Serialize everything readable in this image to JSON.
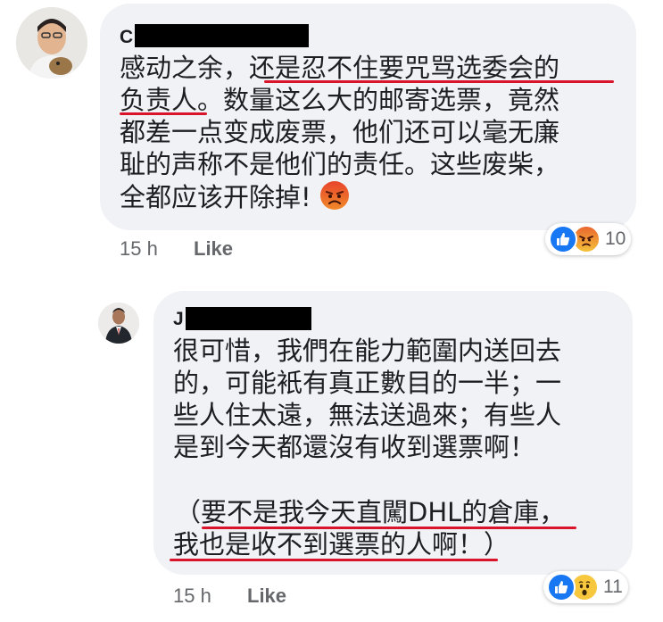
{
  "comment1": {
    "author_initial": "C",
    "lines": [
      "感动之余，还是忍不住要咒骂选委会的",
      "负责人。数量这么大的邮寄选票，竟然",
      "都差一点变成废票，他们还可以毫无廉",
      "耻的声称不是他们的责任。这些废柴，",
      "全都应该开除掉!"
    ],
    "time": "15 h",
    "like_label": "Like",
    "reactions": [
      "like-icon",
      "angry-icon"
    ],
    "reaction_count": "10"
  },
  "comment2": {
    "author_initial": "J",
    "lines": [
      "很可惜，我們在能力範圍内送回去",
      "的，可能衹有真正數目的一半；一",
      "些人住太遠，無法送過來；有些人",
      "是到今天都還沒有收到選票啊！",
      "（要不是我今天直闖DHL的倉庫，",
      "我也是收不到選票的人啊！）"
    ],
    "time": "15 h",
    "like_label": "Like",
    "reactions": [
      "like-icon",
      "wow-icon"
    ],
    "reaction_count": "11"
  },
  "colors": {
    "bubble": "#f0f2f5",
    "underline": "#d9142b",
    "like_blue": "#1877f2",
    "meta_gray": "#65676b"
  }
}
